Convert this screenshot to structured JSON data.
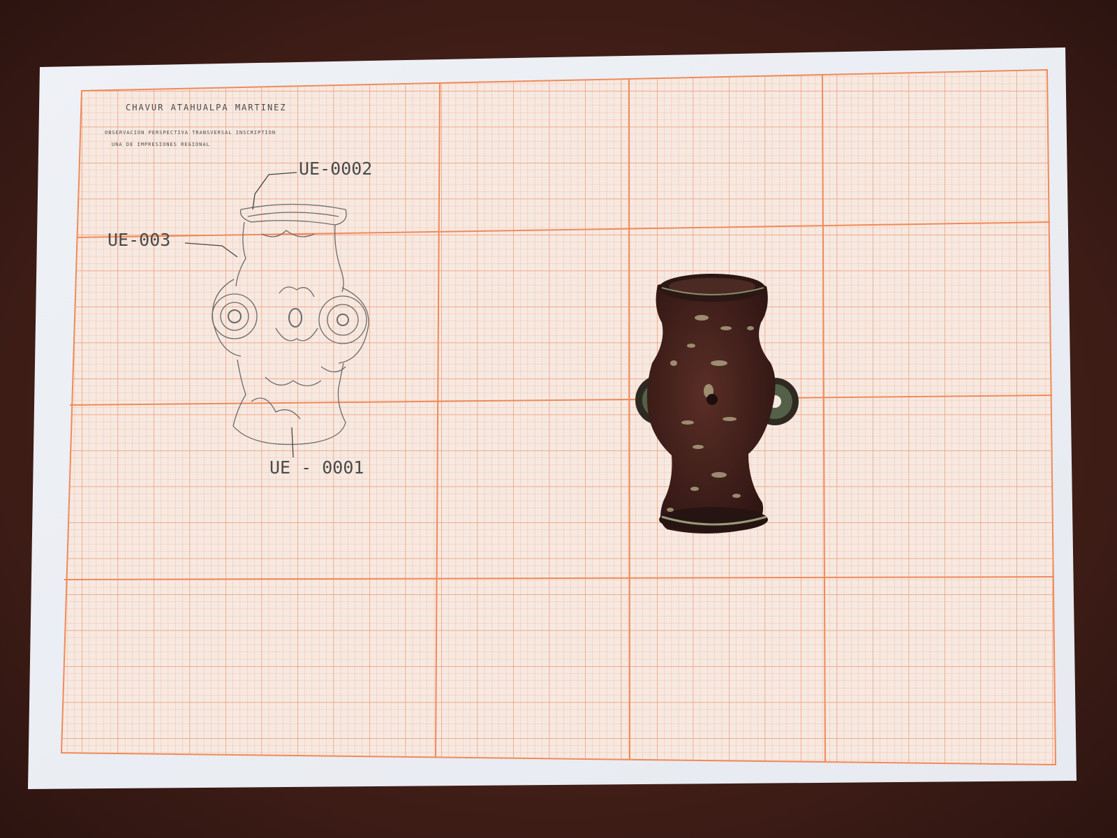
{
  "sheet": {
    "author_line": "CHAVUR ATAHUALPA MARTINEZ",
    "note_line_1": "OBSERVACION PERSPECTIVA TRANSVERSAL INSCRIPTION",
    "note_line_2": "UNA DE IMPRESIONES REGIONAL"
  },
  "labels": {
    "ue_0002": "UE-0002",
    "ue_003": "UE-003",
    "ue_0001": "UE - 0001"
  },
  "colors": {
    "grid_line": "#f4a37a",
    "paper": "#f6ece4",
    "artifact": "#3a1c17"
  }
}
